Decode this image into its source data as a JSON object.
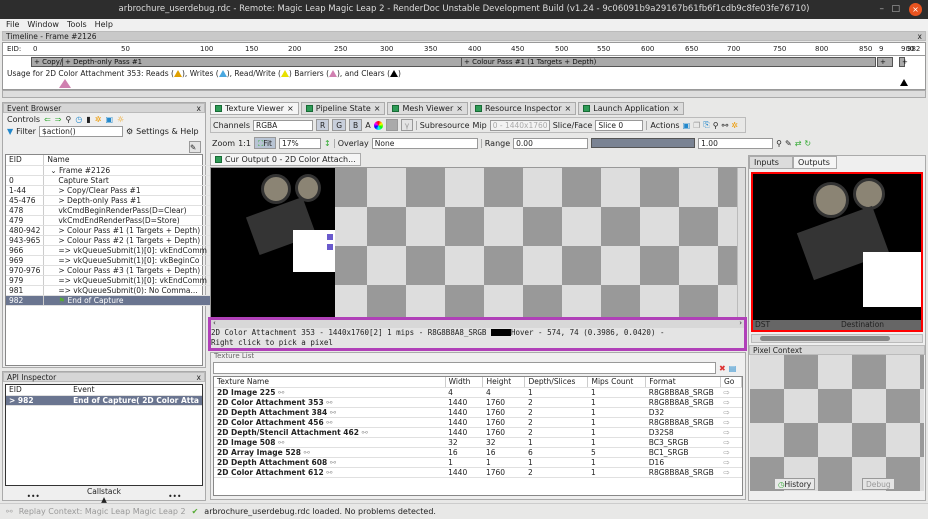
{
  "window": {
    "title": "arbrochure_userdebug.rdc - Remote: Magic Leap Magic Leap 2 - RenderDoc Unstable Development Build (v1.24 - 9c06091b9a29167b61fb6f1cdb9c8fe03fe76710)",
    "close": "×",
    "minimize": "–",
    "maximize": "□"
  },
  "menu": [
    "File",
    "Window",
    "Tools",
    "Help"
  ],
  "timeline": {
    "title": "Timeline - Frame #2126",
    "close": "x",
    "eid_label": "EID:",
    "ticks": [
      "0",
      "50",
      "100",
      "150",
      "200",
      "250",
      "300",
      "350",
      "400",
      "450",
      "500",
      "550",
      "600",
      "650",
      "700",
      "750",
      "800",
      "850",
      "900",
      "9",
      "982"
    ],
    "passes": [
      "+ Copy/...",
      "+ Depth-only Pass #1",
      "+ Colour Pass #1 (1 Targets + Depth)",
      "+",
      "+"
    ],
    "usage_prefix": "Usage for 2D Color Attachment 353: Reads (",
    "reads": "), Writes (",
    "writes": "), Read/Write (",
    "rw": ") Barriers (",
    "barriers": "), and Clears (",
    "end": ")",
    "colors": {
      "reads": "#e0a000",
      "writes": "#4aa8e0",
      "readwrite": "#e8e000",
      "barriers": "#d080b0",
      "clears": "#000000"
    }
  },
  "event_browser": {
    "title": "Event Browser",
    "close": "x",
    "controls": "Controls",
    "filter_label": "Filter",
    "filter_value": "$action()",
    "settings": "Settings & Help",
    "columns": [
      "EID",
      "Name"
    ],
    "rows": [
      {
        "eid": "",
        "name": "⌄ Frame #2126",
        "indent": 0
      },
      {
        "eid": "0",
        "name": "Capture Start",
        "indent": 1
      },
      {
        "eid": "1-44",
        "name": "> Copy/Clear Pass #1",
        "indent": 1
      },
      {
        "eid": "45-476",
        "name": "> Depth-only Pass #1",
        "indent": 1
      },
      {
        "eid": "478",
        "name": "vkCmdBeginRenderPass(D=Clear)",
        "indent": 1
      },
      {
        "eid": "479",
        "name": "vkCmdEndRenderPass(D=Store)",
        "indent": 1
      },
      {
        "eid": "480-942",
        "name": "> Colour Pass #1 (1 Targets + Depth)",
        "indent": 1
      },
      {
        "eid": "943-965",
        "name": "> Colour Pass #2 (1 Targets + Depth)",
        "indent": 1
      },
      {
        "eid": "966",
        "name": "=> vkQueueSubmit(1)[0]: vkEndComm",
        "indent": 1
      },
      {
        "eid": "969",
        "name": "=> vkQueueSubmit(1)[0]: vkBeginCo",
        "indent": 1
      },
      {
        "eid": "970-976",
        "name": "> Colour Pass #3 (1 Targets + Depth)",
        "indent": 1
      },
      {
        "eid": "979",
        "name": "=> vkQueueSubmit(1)[0]: vkEndComm",
        "indent": 1
      },
      {
        "eid": "981",
        "name": "=> vkQueueSubmit(0): No Comma...",
        "indent": 1
      },
      {
        "eid": "982",
        "name": "End of Capture",
        "indent": 1,
        "selected": true
      }
    ]
  },
  "api_inspector": {
    "title": "API Inspector",
    "close": "x",
    "columns": [
      "EID",
      "Event"
    ],
    "row": {
      "eid": "> 982",
      "event": "End of Capture( 2D Color Atta"
    },
    "callstack": "Callstack",
    "dots": "•••"
  },
  "tabs": [
    {
      "label": "Texture Viewer",
      "active": true
    },
    {
      "label": "Pipeline State"
    },
    {
      "label": "Mesh Viewer"
    },
    {
      "label": "Resource Inspector"
    },
    {
      "label": "Launch Application"
    }
  ],
  "texture_viewer": {
    "channels_label": "Channels",
    "channels_value": "RGBA",
    "ch_r": "R",
    "ch_g": "G",
    "ch_b": "B",
    "ch_a": "A",
    "subresource": "Subresource",
    "mip_label": "Mip",
    "mip_value": "0 - 1440x1760",
    "slice_label": "Slice/Face",
    "slice_value": "Slice 0",
    "actions": "Actions",
    "zoom_label": "Zoom",
    "zoom_11": "1:1",
    "fit": "Fit",
    "zoom_value": "17%",
    "overlay_label": "Overlay",
    "overlay_value": "None",
    "range_label": "Range",
    "range_min": "0.00",
    "range_max": "1.00",
    "cur_output_tab": "Cur Output 0 - 2D Color Attach...",
    "status_line1": "2D Color Attachment 353 - 1440x1760[2] 1 mips - R8G8B8A8_SRGB",
    "hover": "Hover -    574,    74 (0.3986, 0.0420)  -",
    "status_line2": "Right click to pick a pixel",
    "highlight_color": "#b040b8"
  },
  "texture_list": {
    "title": "Texture List",
    "columns": [
      "Texture Name",
      "Width",
      "Height",
      "Depth/Slices",
      "Mips Count",
      "Format",
      "Go"
    ],
    "rows": [
      [
        "2D Image 225",
        "4",
        "4",
        "1",
        "1",
        "R8G8B8A8_SRGB"
      ],
      [
        "2D Color Attachment 353",
        "1440",
        "1760",
        "2",
        "1",
        "R8G8B8A8_SRGB"
      ],
      [
        "2D Depth Attachment 384",
        "1440",
        "1760",
        "2",
        "1",
        "D32"
      ],
      [
        "2D Color Attachment 456",
        "1440",
        "1760",
        "2",
        "1",
        "R8G8B8A8_SRGB"
      ],
      [
        "2D Depth/Stencil Attachment 462",
        "1440",
        "1760",
        "2",
        "1",
        "D32S8"
      ],
      [
        "2D Image 508",
        "32",
        "32",
        "1",
        "1",
        "BC3_SRGB"
      ],
      [
        "2D Array Image 528",
        "16",
        "16",
        "6",
        "5",
        "BC1_SRGB"
      ],
      [
        "2D Depth Attachment 608",
        "1",
        "1",
        "1",
        "1",
        "D16"
      ],
      [
        "2D Color Attachment 612",
        "1440",
        "1760",
        "2",
        "1",
        "R8G8B8A8_SRGB"
      ]
    ]
  },
  "right_panel": {
    "tabs": [
      "Inputs",
      "Outputs"
    ],
    "active_tab": "Outputs",
    "thumb_left": "DST",
    "thumb_label": "Destination",
    "thumb_border": "#ff0000",
    "pixel_context": "Pixel Context",
    "history": "History",
    "debug": "Debug"
  },
  "statusbar": {
    "replay": "Replay Context: Magic Leap Magic Leap 2",
    "message": "arbrochure_userdebug.rdc loaded. No problems detected."
  }
}
